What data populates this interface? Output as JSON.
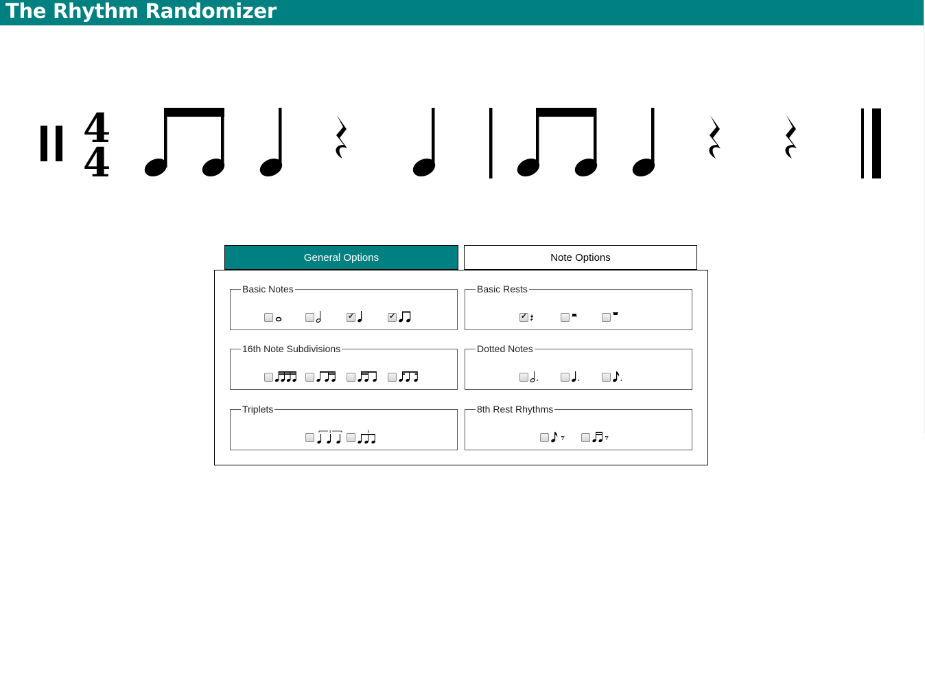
{
  "header": {
    "title": "The Rhythm Randomizer",
    "bg_color": "#008080"
  },
  "notation": {
    "time_signature": {
      "top": "4",
      "bottom": "4"
    },
    "measures": [
      [
        "beamed-eighth-pair",
        "quarter-note",
        "quarter-rest",
        "quarter-note"
      ],
      [
        "beamed-eighth-pair",
        "quarter-note",
        "quarter-rest",
        "quarter-rest"
      ]
    ]
  },
  "tabs": [
    {
      "label": "General Options",
      "active": true
    },
    {
      "label": "Note Options",
      "active": false
    }
  ],
  "groups": {
    "basic_notes": {
      "legend": "Basic Notes",
      "options": [
        {
          "icon": "whole-note-icon",
          "checked": false
        },
        {
          "icon": "half-note-icon",
          "checked": false
        },
        {
          "icon": "quarter-note-icon",
          "checked": true
        },
        {
          "icon": "eighth-pair-icon",
          "checked": true
        }
      ]
    },
    "basic_rests": {
      "legend": "Basic Rests",
      "options": [
        {
          "icon": "quarter-rest-icon",
          "checked": true
        },
        {
          "icon": "half-rest-icon",
          "checked": false
        },
        {
          "icon": "whole-rest-icon",
          "checked": false
        }
      ]
    },
    "sixteenth": {
      "legend": "16th Note Subdivisions",
      "options": [
        {
          "icon": "four-sixteenths-icon",
          "checked": false
        },
        {
          "icon": "eighth-two-sixteenths-icon",
          "checked": false
        },
        {
          "icon": "two-sixteenths-eighth-icon",
          "checked": false
        },
        {
          "icon": "sixteenth-eighth-sixteenth-icon",
          "checked": false
        }
      ]
    },
    "dotted": {
      "legend": "Dotted Notes",
      "options": [
        {
          "icon": "dotted-half-icon",
          "checked": false
        },
        {
          "icon": "dotted-quarter-icon",
          "checked": false
        },
        {
          "icon": "dotted-eighth-icon",
          "checked": false
        }
      ]
    },
    "triplets": {
      "legend": "Triplets",
      "options": [
        {
          "icon": "quarter-triplet-icon",
          "checked": false
        },
        {
          "icon": "eighth-triplet-icon",
          "checked": false
        }
      ]
    },
    "eighth_rest": {
      "legend": "8th Rest Rhythms",
      "options": [
        {
          "icon": "eighth-note-eighth-rest-icon",
          "checked": false
        },
        {
          "icon": "sixteenths-eighth-rest-icon",
          "checked": false
        }
      ]
    }
  }
}
